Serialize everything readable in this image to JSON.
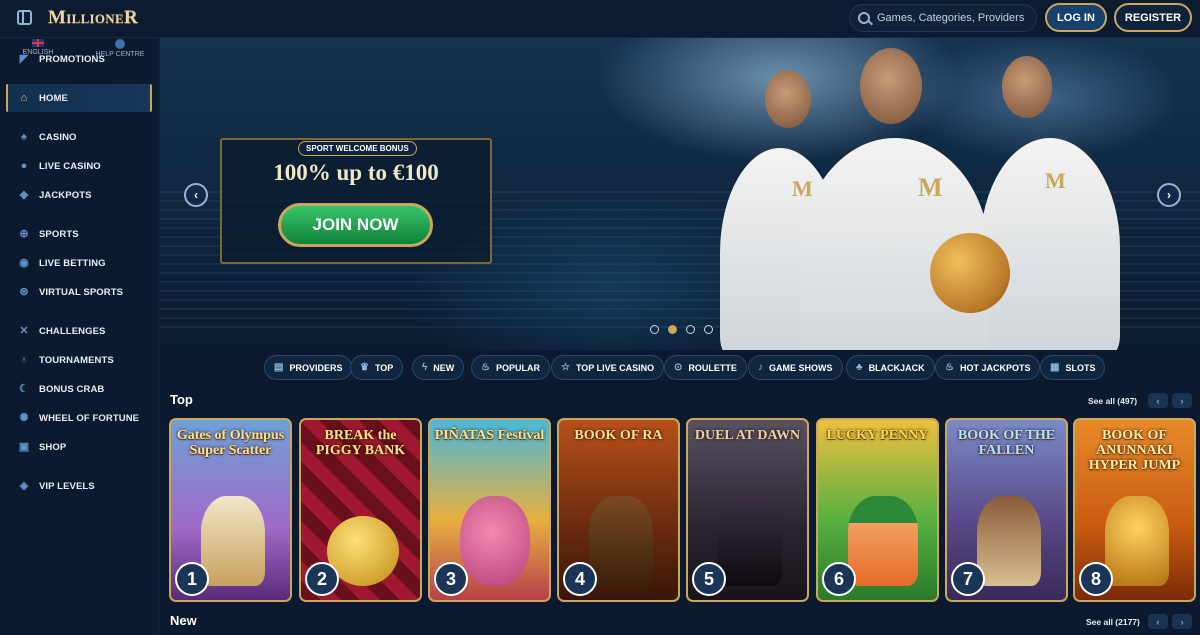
{
  "header": {
    "logo": "MillioneR",
    "search_placeholder": "Games, Categories, Providers",
    "login_label": "LOG IN",
    "register_label": "REGISTER"
  },
  "sidebar": {
    "items": [
      {
        "label": "PROMOTIONS",
        "icon": "megaphone-icon"
      },
      {
        "label": "HOME",
        "icon": "home-icon",
        "active": true
      },
      {
        "label": "CASINO",
        "icon": "spade-icon"
      },
      {
        "label": "LIVE CASINO",
        "icon": "chip-icon"
      },
      {
        "label": "JACKPOTS",
        "icon": "cube-icon"
      },
      {
        "label": "SPORTS",
        "icon": "soccer-icon"
      },
      {
        "label": "LIVE BETTING",
        "icon": "live-icon"
      },
      {
        "label": "VIRTUAL SPORTS",
        "icon": "target-icon"
      },
      {
        "label": "CHALLENGES",
        "icon": "swords-icon"
      },
      {
        "label": "TOURNAMENTS",
        "icon": "medal-icon"
      },
      {
        "label": "BONUS CRAB",
        "icon": "crab-icon"
      },
      {
        "label": "WHEEL OF FORTUNE",
        "icon": "wheel-icon"
      },
      {
        "label": "SHOP",
        "icon": "bag-icon"
      },
      {
        "label": "VIP LEVELS",
        "icon": "diamond-icon"
      }
    ],
    "language": "ENGLISH",
    "help": "HELP CENTRE"
  },
  "banner": {
    "tag": "SPORT WELCOME BONUS",
    "title": "100% up to €100",
    "cta": "JOIN NOW",
    "slides": 4,
    "active_slide": 2
  },
  "categories": [
    {
      "label": "PROVIDERS",
      "icon": "providers-icon"
    },
    {
      "label": "TOP",
      "icon": "crown-icon"
    },
    {
      "label": "NEW",
      "icon": "bolt-icon"
    },
    {
      "label": "POPULAR",
      "icon": "fire-icon"
    },
    {
      "label": "TOP LIVE CASINO",
      "icon": "star-icon"
    },
    {
      "label": "ROULETTE",
      "icon": "roulette-icon"
    },
    {
      "label": "GAME SHOWS",
      "icon": "mic-icon"
    },
    {
      "label": "BLACKJACK",
      "icon": "cards-icon"
    },
    {
      "label": "HOT JACKPOTS",
      "icon": "flame-icon"
    },
    {
      "label": "SLOTS",
      "icon": "slots-icon"
    }
  ],
  "top_section": {
    "title": "Top",
    "see_all": "See all (497)",
    "games": [
      {
        "name": "Gates of Olympus Super Scatter",
        "rank": "1",
        "bg": "#8a4fa8"
      },
      {
        "name": "BREAK the PIGGY BANK",
        "rank": "2",
        "bg": "#8a1224"
      },
      {
        "name": "PIÑATAS Festival",
        "rank": "3",
        "bg": "#3aa0c0"
      },
      {
        "name": "BOOK OF RA",
        "rank": "4",
        "bg": "#8a3a1a"
      },
      {
        "name": "DUEL AT DAWN",
        "rank": "5",
        "bg": "#3a3540"
      },
      {
        "name": "LUCKY PENNY",
        "rank": "6",
        "bg": "#3a9a3a"
      },
      {
        "name": "BOOK OF THE FALLEN",
        "rank": "7",
        "bg": "#4a4a7a"
      },
      {
        "name": "BOOK OF ANUNNAKI HYPER JUMP",
        "rank": "8",
        "bg": "#c86a1a"
      }
    ]
  },
  "new_section": {
    "title": "New",
    "see_all": "See all (2177)"
  },
  "colors": {
    "background": "#0b1a2e",
    "accent_gold": "#c9a85e",
    "join_green": "#12823c"
  }
}
